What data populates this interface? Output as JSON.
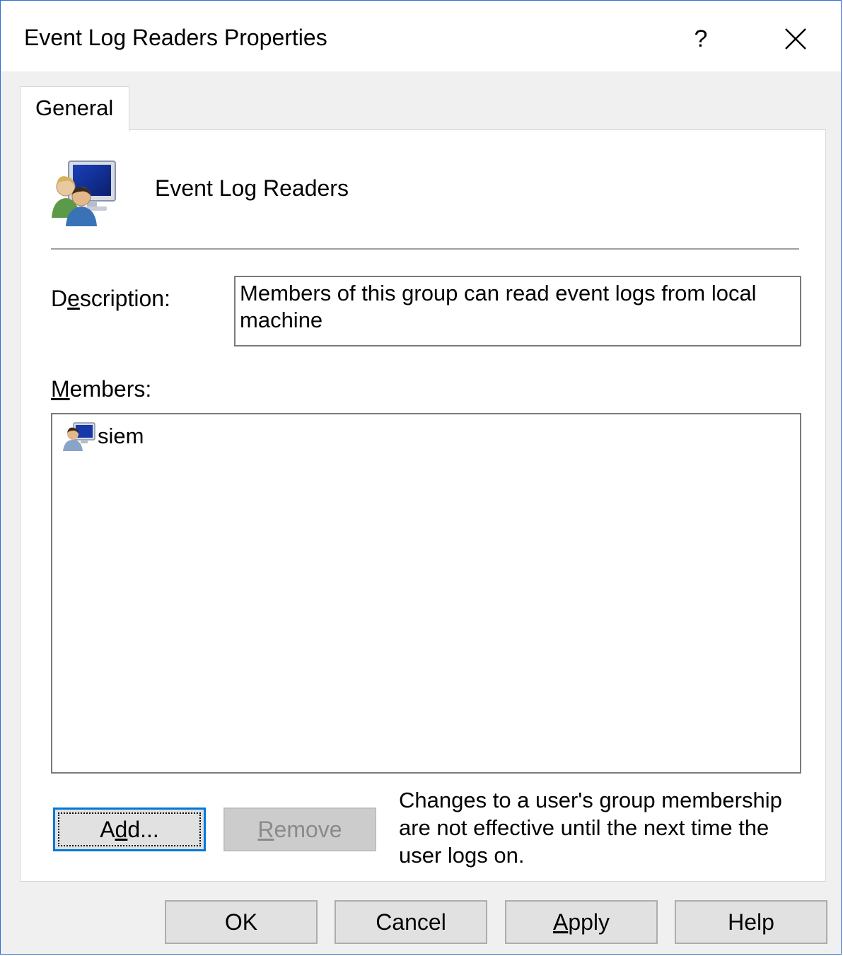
{
  "window": {
    "title": "Event Log Readers Properties",
    "help_glyph": "?",
    "close_glyph": "✕"
  },
  "tabs": [
    {
      "label": "General",
      "selected": true
    }
  ],
  "group": {
    "name": "Event Log Readers",
    "icon": "group-users-icon"
  },
  "description": {
    "label": "Description:",
    "value": "Members of this group can read event logs from local machine"
  },
  "members": {
    "label": "Members:",
    "items": [
      {
        "name": "siem",
        "icon": "user-computer-icon"
      }
    ]
  },
  "buttons": {
    "add": "Add...",
    "remove": "Remove",
    "ok": "OK",
    "cancel": "Cancel",
    "apply": "Apply",
    "help": "Help"
  },
  "note": "Changes to a user's group membership are not effective until the next time the user logs on.",
  "colors": {
    "accent": "#0078d7",
    "dialog_bg": "#f0f0f0",
    "button_bg": "#e1e1e1",
    "disabled_text": "#8a8a8a"
  }
}
